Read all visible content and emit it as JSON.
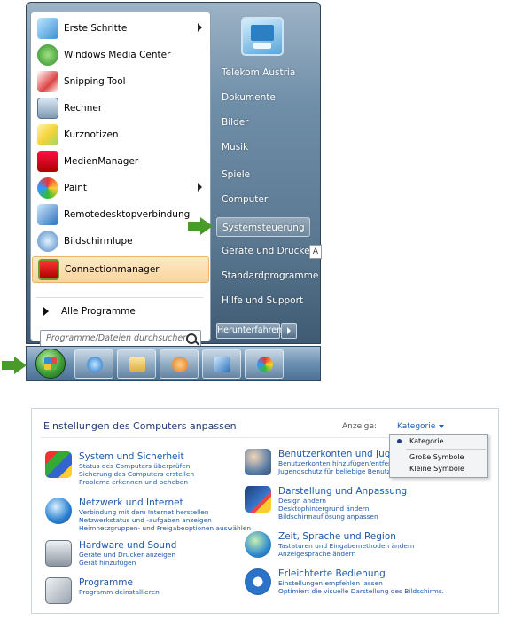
{
  "start_menu": {
    "programs": [
      {
        "label": "Erste Schritte",
        "icon": "getting-started-icon",
        "submenu": true
      },
      {
        "label": "Windows Media Center",
        "icon": "media-center-icon",
        "submenu": false
      },
      {
        "label": "Snipping Tool",
        "icon": "scissors-icon",
        "submenu": false
      },
      {
        "label": "Rechner",
        "icon": "calculator-icon",
        "submenu": false
      },
      {
        "label": "Kurznotizen",
        "icon": "sticky-notes-icon",
        "submenu": false
      },
      {
        "label": "MedienManager",
        "icon": "media-manager-icon",
        "submenu": false
      },
      {
        "label": "Paint",
        "icon": "paint-icon",
        "submenu": true
      },
      {
        "label": "Remotedesktopverbindung",
        "icon": "remote-desktop-icon",
        "submenu": false
      },
      {
        "label": "Bildschirmlupe",
        "icon": "magnifier-icon",
        "submenu": false
      },
      {
        "label": "Connectionmanager",
        "icon": "connection-manager-icon",
        "submenu": false
      }
    ],
    "all_programs": "Alle Programme",
    "search_placeholder": "Programme/Dateien durchsuchen",
    "right_items": [
      "Telekom Austria",
      "Dokumente",
      "Bilder",
      "Musik",
      "Spiele",
      "Computer",
      "Systemsteuerung",
      "Geräte und Drucker",
      "Standardprogramme",
      "Hilfe und Support"
    ],
    "shutdown_label": "Herunterfahren",
    "tooltip_char": "A"
  },
  "taskbar": {
    "buttons": [
      "internet-explorer-icon",
      "file-explorer-icon",
      "media-player-icon",
      "remote-desktop-icon",
      "paint-icon"
    ]
  },
  "control_panel": {
    "title": "Einstellungen des Computers anpassen",
    "view_label": "Anzeige:",
    "view_value": "Kategorie",
    "dropdown_options": [
      "Kategorie",
      "Große Symbole",
      "Kleine Symbole"
    ],
    "categories_left": [
      {
        "title": "System und Sicherheit",
        "links": [
          "Status des Computers überprüfen",
          "Sicherung des Computers erstellen",
          "Probleme erkennen und beheben"
        ]
      },
      {
        "title": "Netzwerk und Internet",
        "links": [
          "Verbindung mit dem Internet herstellen",
          "Netzwerkstatus und -aufgaben anzeigen",
          "Heimnetzgruppen- und Freigabeoptionen auswählen"
        ]
      },
      {
        "title": "Hardware und Sound",
        "links": [
          "Geräte und Drucker anzeigen",
          "Gerät hinzufügen"
        ]
      },
      {
        "title": "Programme",
        "links": [
          "Programm deinstallieren"
        ]
      }
    ],
    "categories_right": [
      {
        "title": "Benutzerkonten und Jugendsc",
        "links": [
          "Benutzerkonten hinzufügen/entfern",
          "Jugendschutz für beliebige Benutze"
        ]
      },
      {
        "title": "Darstellung und Anpassung",
        "links": [
          "Design ändern",
          "Desktophintergrund ändern",
          "Bildschirmauflösung anpassen"
        ]
      },
      {
        "title": "Zeit, Sprache und Region",
        "links": [
          "Tastaturen und Eingabemethoden ändern",
          "Anzeigesprache ändern"
        ]
      },
      {
        "title": "Erleichterte Bedienung",
        "links": [
          "Einstellungen empfehlen lassen",
          "Optimiert die visuelle Darstellung des Bildschirms."
        ]
      }
    ]
  }
}
